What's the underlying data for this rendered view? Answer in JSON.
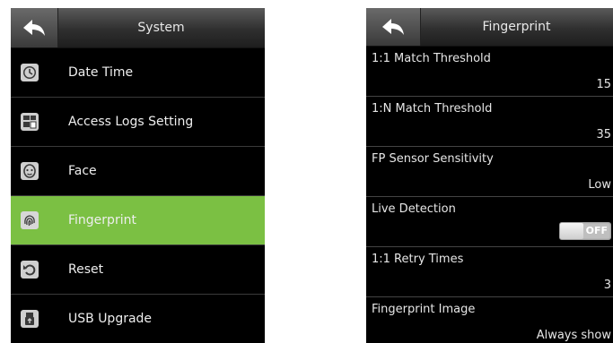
{
  "left_panel": {
    "title": "System",
    "items": [
      {
        "label": "Date Time",
        "icon": "clock-icon"
      },
      {
        "label": "Access Logs Setting",
        "icon": "logs-icon"
      },
      {
        "label": "Face",
        "icon": "face-icon"
      },
      {
        "label": "Fingerprint",
        "icon": "fingerprint-icon",
        "active": true
      },
      {
        "label": "Reset",
        "icon": "reset-icon"
      },
      {
        "label": "USB Upgrade",
        "icon": "usb-icon"
      }
    ]
  },
  "right_panel": {
    "title": "Fingerprint",
    "settings": [
      {
        "label": "1:1 Match Threshold",
        "value": "15"
      },
      {
        "label": "1:N Match Threshold",
        "value": "35"
      },
      {
        "label": "FP Sensor Sensitivity",
        "value": "Low"
      },
      {
        "label": "Live Detection",
        "toggle": "OFF"
      },
      {
        "label": "1:1 Retry Times",
        "value": "3"
      },
      {
        "label": "Fingerprint Image",
        "value": "Always show"
      }
    ]
  },
  "colors": {
    "active_item": "#7bc043",
    "background": "#000000",
    "header": "#3a3a3a"
  }
}
